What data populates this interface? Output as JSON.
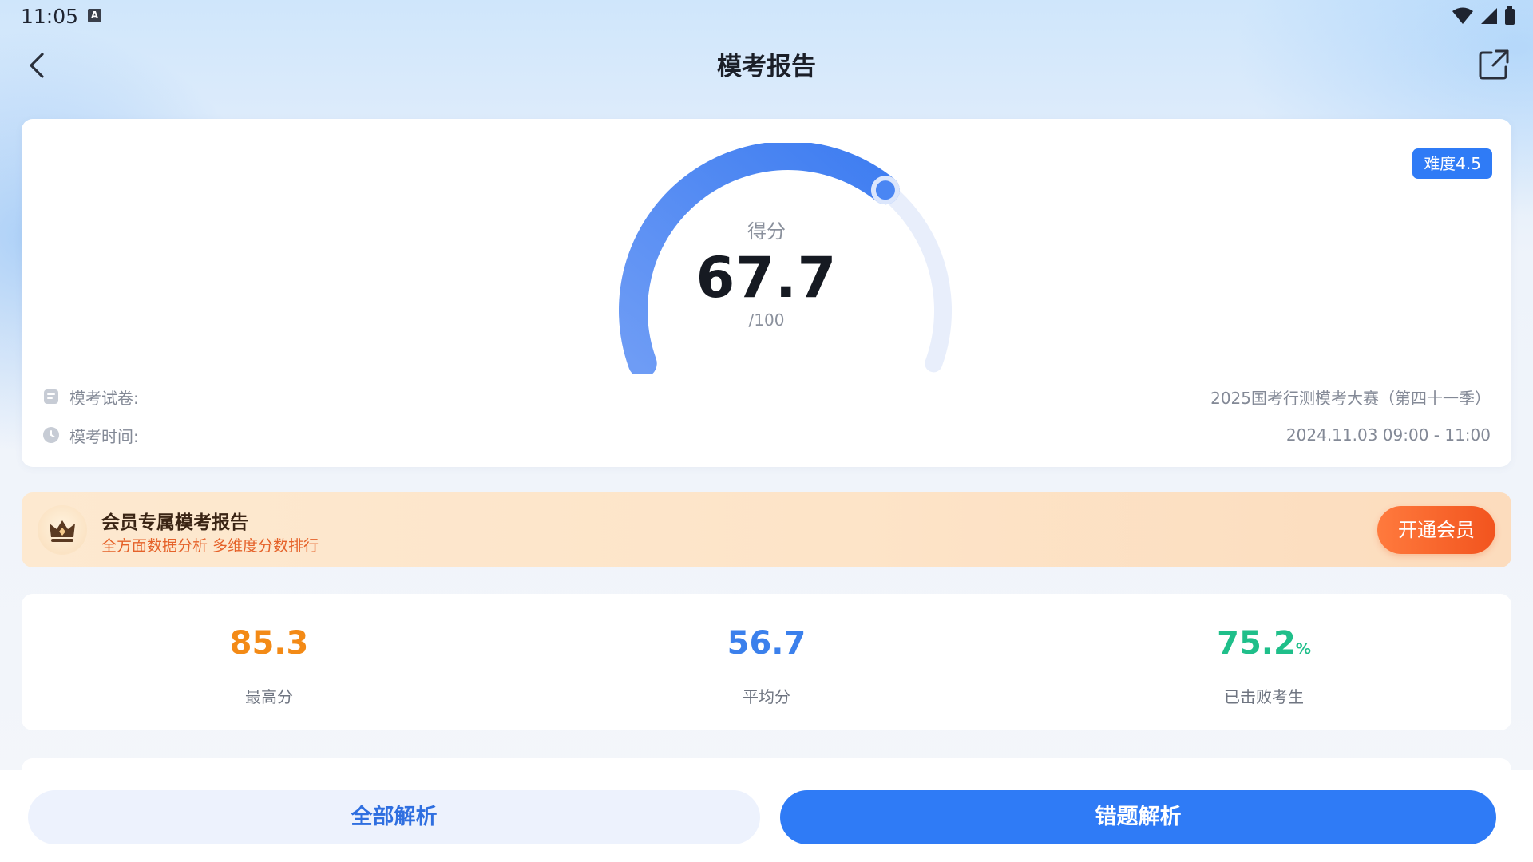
{
  "status_bar": {
    "time": "11:05",
    "notification_glyph": "A",
    "icons": [
      "wifi-icon",
      "signal-icon",
      "battery-icon"
    ]
  },
  "nav": {
    "title": "模考报告",
    "back_icon": "chevron-left-icon",
    "share_icon": "share-external-icon"
  },
  "score": {
    "label": "得分",
    "value": "67.7",
    "total": "/100",
    "progress_fraction": 0.677,
    "difficulty": "难度4.5",
    "gauge_color": "#4a86f3",
    "gauge_track_color": "#e8eefb"
  },
  "exam_info": {
    "paper_label": "模考试卷:",
    "paper_value": "2025国考行测模考大赛（第四十一季）",
    "time_label": "模考时间:",
    "time_value": "2024.11.03 09:00 - 11:00"
  },
  "member": {
    "title": "会员专属模考报告",
    "subtitle": "全方面数据分析 多维度分数排行",
    "button": "开通会员",
    "icon": "crown-icon"
  },
  "stats": [
    {
      "value": "85.3",
      "unit": "",
      "label": "最高分",
      "color": "#f38a16"
    },
    {
      "value": "56.7",
      "unit": "",
      "label": "平均分",
      "color": "#3b80ec"
    },
    {
      "value": "75.2",
      "unit": "%",
      "label": "已击败考生",
      "color": "#1fbf8a"
    }
  ],
  "actions": {
    "all_analysis": "全部解析",
    "wrong_analysis": "错题解析"
  }
}
